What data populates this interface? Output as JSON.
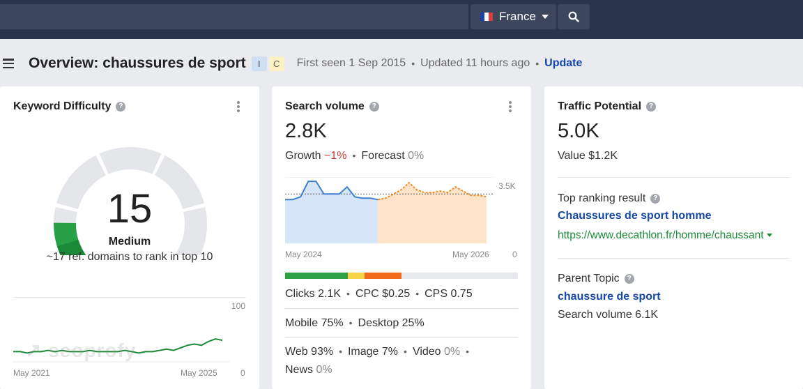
{
  "topbar": {
    "country": "France",
    "icons": [
      "flag-fr-icon",
      "caret-down-icon",
      "search-icon"
    ]
  },
  "header": {
    "title": "Overview: chaussures de sport",
    "badges": [
      "I",
      "C"
    ],
    "first_seen": "First seen 1 Sep 2015",
    "updated": "Updated 11 hours ago",
    "update_link": "Update"
  },
  "kd": {
    "title": "Keyword Difficulty",
    "score": "15",
    "score_value": 15,
    "label": "Medium",
    "desc": "~17 ref. domains to rank in top 10",
    "chart": {
      "y_max": "100",
      "y_min": "0",
      "x_start": "May 2021",
      "x_end": "May 2025",
      "watermark": "seoprofy",
      "values": [
        8,
        8,
        7,
        8,
        8,
        9,
        8,
        9,
        8,
        8,
        8,
        9,
        8,
        8,
        8,
        8,
        9,
        8,
        7,
        8,
        8,
        9,
        10,
        9,
        11,
        13,
        14,
        13,
        16,
        18,
        17
      ]
    }
  },
  "sv": {
    "title": "Search volume",
    "value": "2.8K",
    "growth_label": "Growth",
    "growth_value": "−1%",
    "forecast_label": "Forecast",
    "forecast_value": "0%",
    "chart": {
      "y_ref": "3.5K",
      "y_min": "0",
      "x_start": "May 2024",
      "x_end": "May 2026",
      "ref_value": 3.5,
      "y_max": 4.7,
      "history": [
        3.1,
        3.1,
        3.3,
        4.4,
        4.4,
        3.5,
        3.5,
        3.5,
        4.0,
        3.3,
        3.2,
        3.2,
        3.1
      ],
      "forecast": [
        3.1,
        3.2,
        3.5,
        3.8,
        4.3,
        3.8,
        3.6,
        3.6,
        3.7,
        3.6,
        4.0,
        3.7,
        3.4,
        3.4,
        3.3
      ]
    },
    "intent_split": [
      {
        "share": 27,
        "color": "#2ea043"
      },
      {
        "share": 7,
        "color": "#f5d547"
      },
      {
        "share": 16,
        "color": "#f06a1a"
      },
      {
        "share": 50,
        "color": "#e6e8eb"
      }
    ],
    "clicks": "Clicks 2.1K",
    "cpc": "CPC $0.25",
    "cps": "CPS 0.75",
    "mobile": "Mobile 75%",
    "desktop": "Desktop 25%",
    "web": "Web 93%",
    "image": "Image 7%",
    "video_label": "Video",
    "video_value": "0%",
    "news_label": "News",
    "news_value": "0%"
  },
  "tp": {
    "title": "Traffic Potential",
    "value": "5.0K",
    "value_line": "Value $1.2K",
    "top_result_label": "Top ranking result",
    "top_result_title": "Chaussures de sport homme",
    "top_result_url": "https://www.decathlon.fr/homme/chaussant",
    "parent_label": "Parent Topic",
    "parent_topic": "chaussure de sport",
    "parent_sv": "Search volume 6.1K"
  }
}
